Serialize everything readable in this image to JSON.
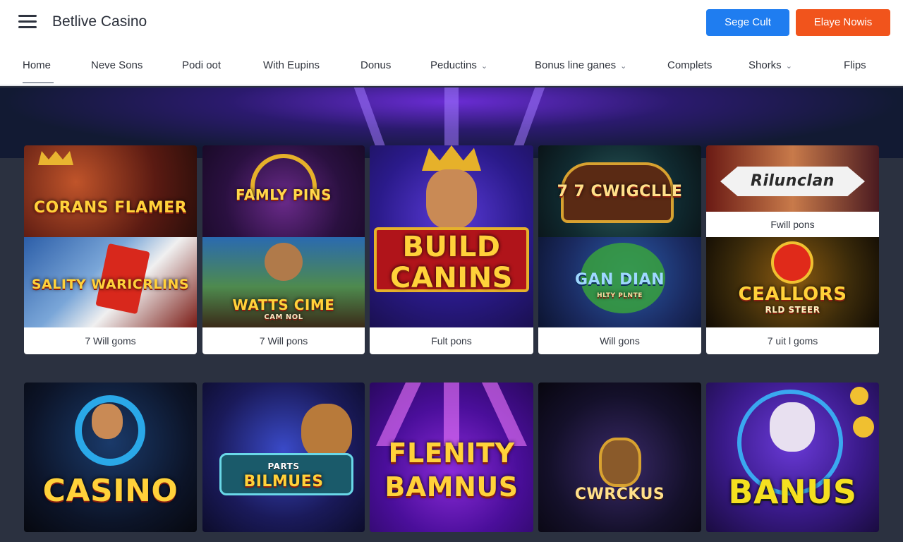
{
  "header": {
    "brand": "Betlive Casino",
    "signup_label": "Sege Cult",
    "play_label": "Elaye Nowis"
  },
  "nav": {
    "items": [
      {
        "label": "Home",
        "dropdown": false
      },
      {
        "label": "Neve Sons",
        "dropdown": false
      },
      {
        "label": "Podi oot",
        "dropdown": false
      },
      {
        "label": "With Eupins",
        "dropdown": false
      },
      {
        "label": "Donus",
        "dropdown": false
      },
      {
        "label": "Peductins",
        "dropdown": true
      },
      {
        "label": "Bonus line ganes",
        "dropdown": true
      },
      {
        "label": "Complets",
        "dropdown": false
      },
      {
        "label": "Shorks",
        "dropdown": true
      },
      {
        "label": "Flips",
        "dropdown": false
      }
    ],
    "active": "Home"
  },
  "games_row1": [
    {
      "art_top": "CORANS FLAMER",
      "art_bottom": "SALITY WARICRLINS",
      "caption": "7 Will goms"
    },
    {
      "art_top": "FAMLY PINS",
      "art_bottom": "WATTS CIME",
      "art_bottom_sub": "CAM NOL",
      "caption": "7 Will pons"
    },
    {
      "art_top": "BUILD CANINS",
      "caption": "Fult pons"
    },
    {
      "art_top": "7 7 CWIGCLLE",
      "art_bottom": "GAN DIAN",
      "art_bottom_sub": "HLTY PLNTE",
      "caption": "Will gons"
    },
    {
      "art_top": "Rilunclan",
      "caption_top": "Fwill pons",
      "art_bottom": "CEALLORS",
      "art_bottom_sub": "RLD STEER",
      "caption": "7 uit l goms"
    }
  ],
  "games_row2": [
    {
      "title": "CASINO"
    },
    {
      "title": "BILMUES",
      "subtitle": "PARTS"
    },
    {
      "title": "FLENITY BAMNUS"
    },
    {
      "title": "CWRCKUS"
    },
    {
      "title": "BANUS"
    }
  ],
  "colors": {
    "signup_button": "#1f7df0",
    "play_button": "#f1541c",
    "page_background": "#2b3140",
    "hero_glow": "#6a2cd4"
  },
  "icons": {
    "menu": "hamburger-icon",
    "dropdown": "chevron-down-icon"
  }
}
